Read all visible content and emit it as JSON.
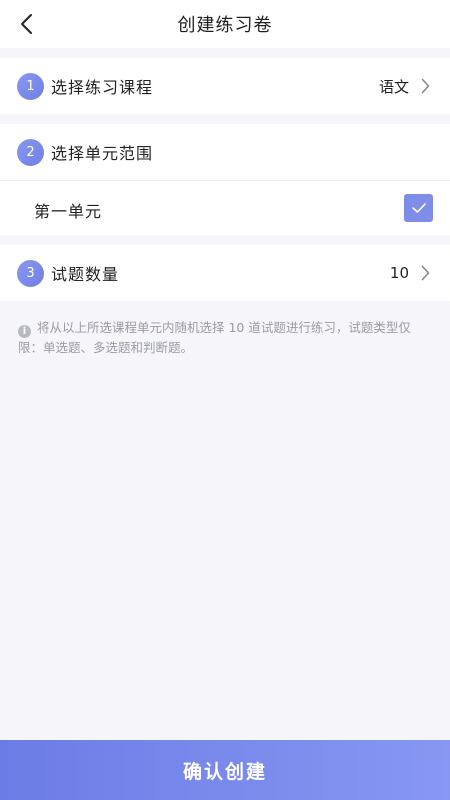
{
  "header": {
    "title": "创建练习卷",
    "back_icon": "chevron-left-icon"
  },
  "steps": [
    {
      "number": "1",
      "label": "选择练习课程",
      "value": "语文"
    },
    {
      "number": "2",
      "label": "选择单元范围"
    },
    {
      "number": "3",
      "label": "试题数量",
      "value": "10"
    }
  ],
  "units": [
    {
      "label": "第一单元",
      "checked": true
    }
  ],
  "hint": {
    "icon": "info-icon",
    "icon_glyph": "i",
    "text": "将从以上所选课程单元内随机选择 10 道试题进行练习，试题类型仅限：单选题、多选题和判断题。"
  },
  "footer": {
    "confirm_label": "确认创建"
  },
  "colors": {
    "accent": "#7e8de8",
    "background": "#f6f6fa",
    "hint_text": "#9b9ba6"
  }
}
